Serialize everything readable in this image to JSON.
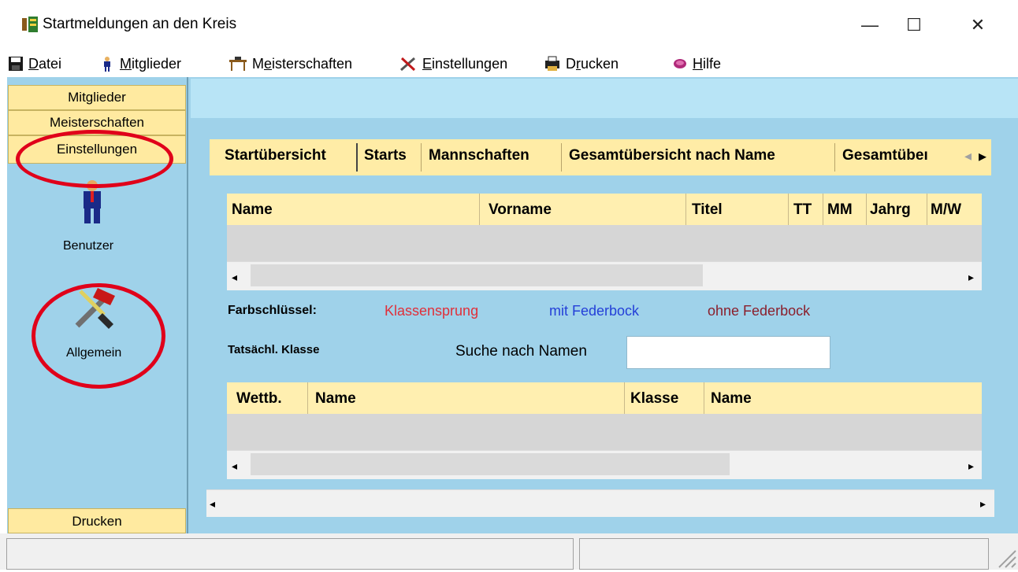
{
  "window": {
    "title": "Startmeldungen an den Kreis",
    "minimize_glyph": "—",
    "maximize_glyph": "☐",
    "close_glyph": "✕"
  },
  "menu": {
    "items": [
      {
        "label_prefix": "",
        "label_underlined": "D",
        "label_rest": "atei",
        "icon": "floppy-disk-icon"
      },
      {
        "label_prefix": "",
        "label_underlined": "M",
        "label_rest": "itglieder",
        "icon": "person-icon"
      },
      {
        "label_prefix": "M",
        "label_underlined": "e",
        "label_rest": "isterschaften",
        "icon": "trophy-table-icon"
      },
      {
        "label_prefix": "",
        "label_underlined": "E",
        "label_rest": "instellungen",
        "icon": "tools-icon"
      },
      {
        "label_prefix": "D",
        "label_underlined": "r",
        "label_rest": "ucken",
        "icon": "printer-icon"
      },
      {
        "label_prefix": "",
        "label_underlined": "H",
        "label_rest": "ilfe",
        "icon": "help-book-icon"
      }
    ]
  },
  "nav": {
    "mitglieder": "Mitglieder",
    "meisterschaften": "Meisterschaften",
    "einstellungen": "Einstellungen",
    "benutzer": "Benutzer",
    "allgemein": "Allgemein",
    "drucken": "Drucken"
  },
  "tabs": {
    "items": [
      "Startübersicht",
      "Starts",
      "Mannschaften",
      "Gesamtübersicht nach Name",
      "Gesamtübeı"
    ],
    "left_arrow": "◂",
    "right_arrow": "▸"
  },
  "grid1": {
    "columns": [
      "Name",
      "Vorname",
      "Titel",
      "TT",
      "MM",
      "Jahrg",
      "M/W"
    ]
  },
  "legend": {
    "label": "Farbschlüssel:",
    "klassensprung": "Klassensprung",
    "mit_federbock": "mit Federbock",
    "ohne_federbock": "ohne Federbock",
    "klassensprung_color": "#e0303a",
    "mit_federbock_color": "#2440d8",
    "ohne_federbock_color": "#8a1f2c"
  },
  "search": {
    "tatsaechl_label": "Tatsächl. Klasse",
    "label": "Suche nach Namen",
    "value": ""
  },
  "grid2": {
    "columns": [
      "Wettb.",
      "Name",
      "Klasse",
      "Name"
    ]
  },
  "scroll": {
    "left": "◂",
    "right": "▸"
  }
}
